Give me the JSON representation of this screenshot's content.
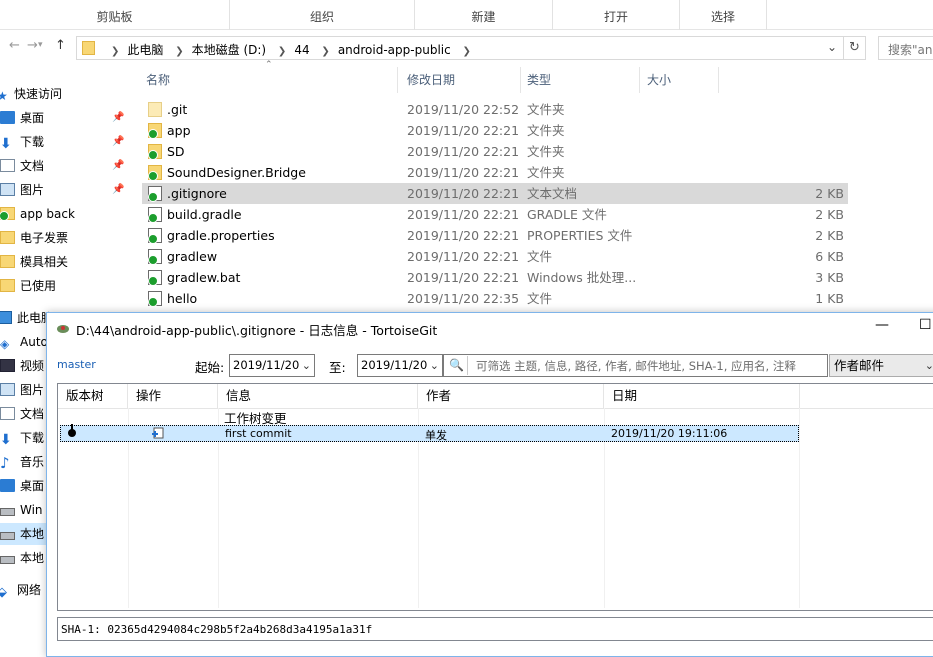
{
  "ribbon": {
    "groups": [
      "剪贴板",
      "组织",
      "新建",
      "打开",
      "选择"
    ]
  },
  "address": {
    "crumbs": [
      "此电脑",
      "本地磁盘 (D:)",
      "44",
      "android-app-public"
    ],
    "search_placeholder": "搜索\"android-app-public\""
  },
  "nav": {
    "quick_access": "快速访问",
    "items": [
      {
        "label": "桌面",
        "icon": "desktop-icon",
        "pinned": true
      },
      {
        "label": "下载",
        "icon": "download-icon",
        "pinned": true
      },
      {
        "label": "文档",
        "icon": "document-icon",
        "pinned": true
      },
      {
        "label": "图片",
        "icon": "picture-icon",
        "pinned": true
      },
      {
        "label": "app back",
        "icon": "git-folder-icon",
        "pinned": false
      },
      {
        "label": "电子发票",
        "icon": "folder-icon",
        "pinned": false
      },
      {
        "label": "模具相关",
        "icon": "folder-icon",
        "pinned": false
      },
      {
        "label": "已使用",
        "icon": "folder-icon",
        "pinned": false
      }
    ],
    "this_pc": "此电脑",
    "pc_items": [
      {
        "label": "Auto",
        "icon": "3d-objects-icon"
      },
      {
        "label": "视频",
        "icon": "video-icon"
      },
      {
        "label": "图片",
        "icon": "picture-icon"
      },
      {
        "label": "文档",
        "icon": "document-icon"
      },
      {
        "label": "下载",
        "icon": "download-icon"
      },
      {
        "label": "音乐",
        "icon": "music-icon"
      },
      {
        "label": "桌面",
        "icon": "desktop-icon"
      },
      {
        "label": "Win",
        "icon": "drive-icon"
      },
      {
        "label": "本地",
        "icon": "drive-icon"
      },
      {
        "label": "本地",
        "icon": "drive-icon"
      }
    ],
    "network": "网络"
  },
  "filelist": {
    "columns": {
      "name": "名称",
      "modified": "修改日期",
      "type": "类型",
      "size": "大小"
    },
    "rows": [
      {
        "name": ".git",
        "modified": "2019/11/20 22:52",
        "type": "文件夹",
        "size": "",
        "icon": "folder-icon",
        "git": false,
        "selected": false
      },
      {
        "name": "app",
        "modified": "2019/11/20 22:21",
        "type": "文件夹",
        "size": "",
        "icon": "git-folder-icon",
        "git": true,
        "selected": false
      },
      {
        "name": "SD",
        "modified": "2019/11/20 22:21",
        "type": "文件夹",
        "size": "",
        "icon": "git-folder-icon",
        "git": true,
        "selected": false
      },
      {
        "name": "SoundDesigner.Bridge",
        "modified": "2019/11/20 22:21",
        "type": "文件夹",
        "size": "",
        "icon": "git-folder-icon",
        "git": true,
        "selected": false
      },
      {
        "name": ".gitignore",
        "modified": "2019/11/20 22:21",
        "type": "文本文档",
        "size": "2 KB",
        "icon": "git-file-icon",
        "git": true,
        "selected": true
      },
      {
        "name": "build.gradle",
        "modified": "2019/11/20 22:21",
        "type": "GRADLE 文件",
        "size": "2 KB",
        "icon": "git-file-icon",
        "git": true,
        "selected": false
      },
      {
        "name": "gradle.properties",
        "modified": "2019/11/20 22:21",
        "type": "PROPERTIES 文件",
        "size": "2 KB",
        "icon": "git-file-icon",
        "git": true,
        "selected": false
      },
      {
        "name": "gradlew",
        "modified": "2019/11/20 22:21",
        "type": "文件",
        "size": "6 KB",
        "icon": "git-file-icon",
        "git": true,
        "selected": false
      },
      {
        "name": "gradlew.bat",
        "modified": "2019/11/20 22:21",
        "type": "Windows 批处理...",
        "size": "3 KB",
        "icon": "git-file-icon",
        "git": true,
        "selected": false
      },
      {
        "name": "hello",
        "modified": "2019/11/20 22:35",
        "type": "文件",
        "size": "1 KB",
        "icon": "git-file-icon",
        "git": true,
        "selected": false
      }
    ]
  },
  "logdialog": {
    "title": "D:\\44\\android-app-public\\.gitignore - 日志信息 - TortoiseGit",
    "branch": "master",
    "from_label": "起始:",
    "from_date": "2019/11/20",
    "to_label": "至:",
    "to_date": "2019/11/20",
    "filter_placeholder": "可筛选 主题, 信息, 路径, 作者, 邮件地址, SHA-1, 应用名, 注释",
    "filter_field": "作者邮件",
    "columns": {
      "graph": "版本树",
      "actions": "操作",
      "message": "信息",
      "author": "作者",
      "date": "日期"
    },
    "worktree_row": "工作树变更",
    "commit": {
      "message": "first  commit",
      "author": "单发",
      "date": "2019/11/20 19:11:06"
    },
    "sha": "SHA-1: 02365d4294084c298b5f2a4b268d3a4195a1a31f"
  }
}
